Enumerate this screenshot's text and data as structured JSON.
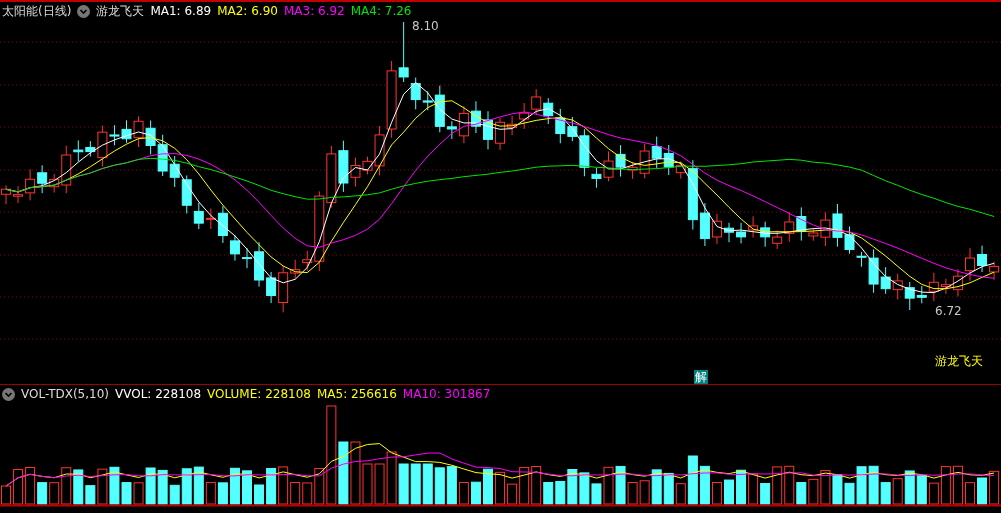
{
  "header": {
    "title": "太阳能(日线)",
    "indicator": "游龙飞天",
    "averages": [
      {
        "label": "MA1: 6.89",
        "color": "#ffffff"
      },
      {
        "label": "MA2: 6.90",
        "color": "#ffff00"
      },
      {
        "label": "MA3: 6.92",
        "color": "#ff00ff"
      },
      {
        "label": "MA4: 7.26",
        "color": "#00e600"
      }
    ]
  },
  "price_chart": {
    "high_label": "8.10",
    "low_label": "6.72",
    "badge": "解",
    "indicator_tag": "游龙飞天"
  },
  "volume_panel": {
    "indicator": "VOL-TDX(5,10)",
    "values": [
      {
        "label": "VVOL: 228108",
        "color": "#ffffff"
      },
      {
        "label": "VOLUME: 228108",
        "color": "#ffff00"
      },
      {
        "label": "MA5: 256616",
        "color": "#ffff00"
      },
      {
        "label": "MA10: 301867",
        "color": "#ff00ff"
      }
    ]
  }
}
